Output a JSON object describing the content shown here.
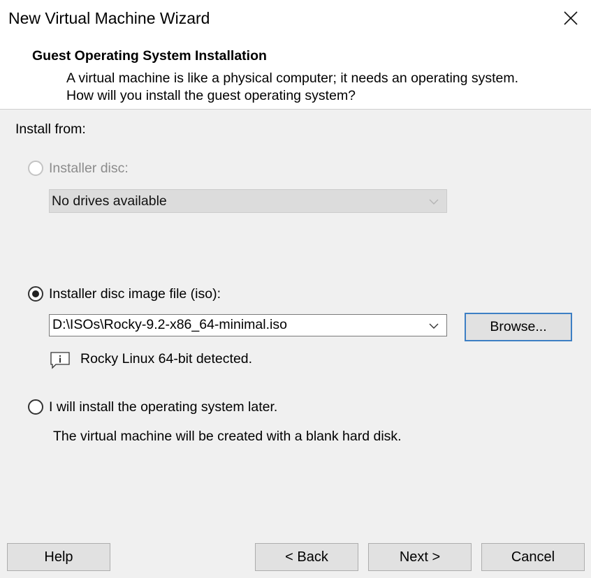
{
  "window": {
    "title": "New Virtual Machine Wizard",
    "close_icon": "close-icon"
  },
  "header": {
    "title": "Guest Operating System Installation",
    "description": "A virtual machine is like a physical computer; it needs an operating system. How will you install the guest operating system?"
  },
  "install_from": {
    "label": "Install from:",
    "installer_disc": {
      "label": "Installer disc:",
      "selected": false,
      "enabled": false,
      "dropdown_value": "No drives available"
    },
    "iso": {
      "label": "Installer disc image file (iso):",
      "selected": true,
      "path": "D:\\ISOs\\Rocky-9.2-x86_64-minimal.iso",
      "browse_label": "Browse...",
      "detected_message": "Rocky Linux 64-bit detected.",
      "info_icon": "info-icon"
    },
    "later": {
      "label": "I will install the operating system later.",
      "selected": false,
      "description": "The virtual machine will be created with a blank hard disk."
    }
  },
  "footer": {
    "help_label": "Help",
    "back_label": "< Back",
    "next_label": "Next >",
    "cancel_label": "Cancel"
  },
  "colors": {
    "background": "#f0f0f0",
    "header_background": "#ffffff",
    "focus_border": "#3d7fc4",
    "disabled_text": "#8c8c8c"
  }
}
